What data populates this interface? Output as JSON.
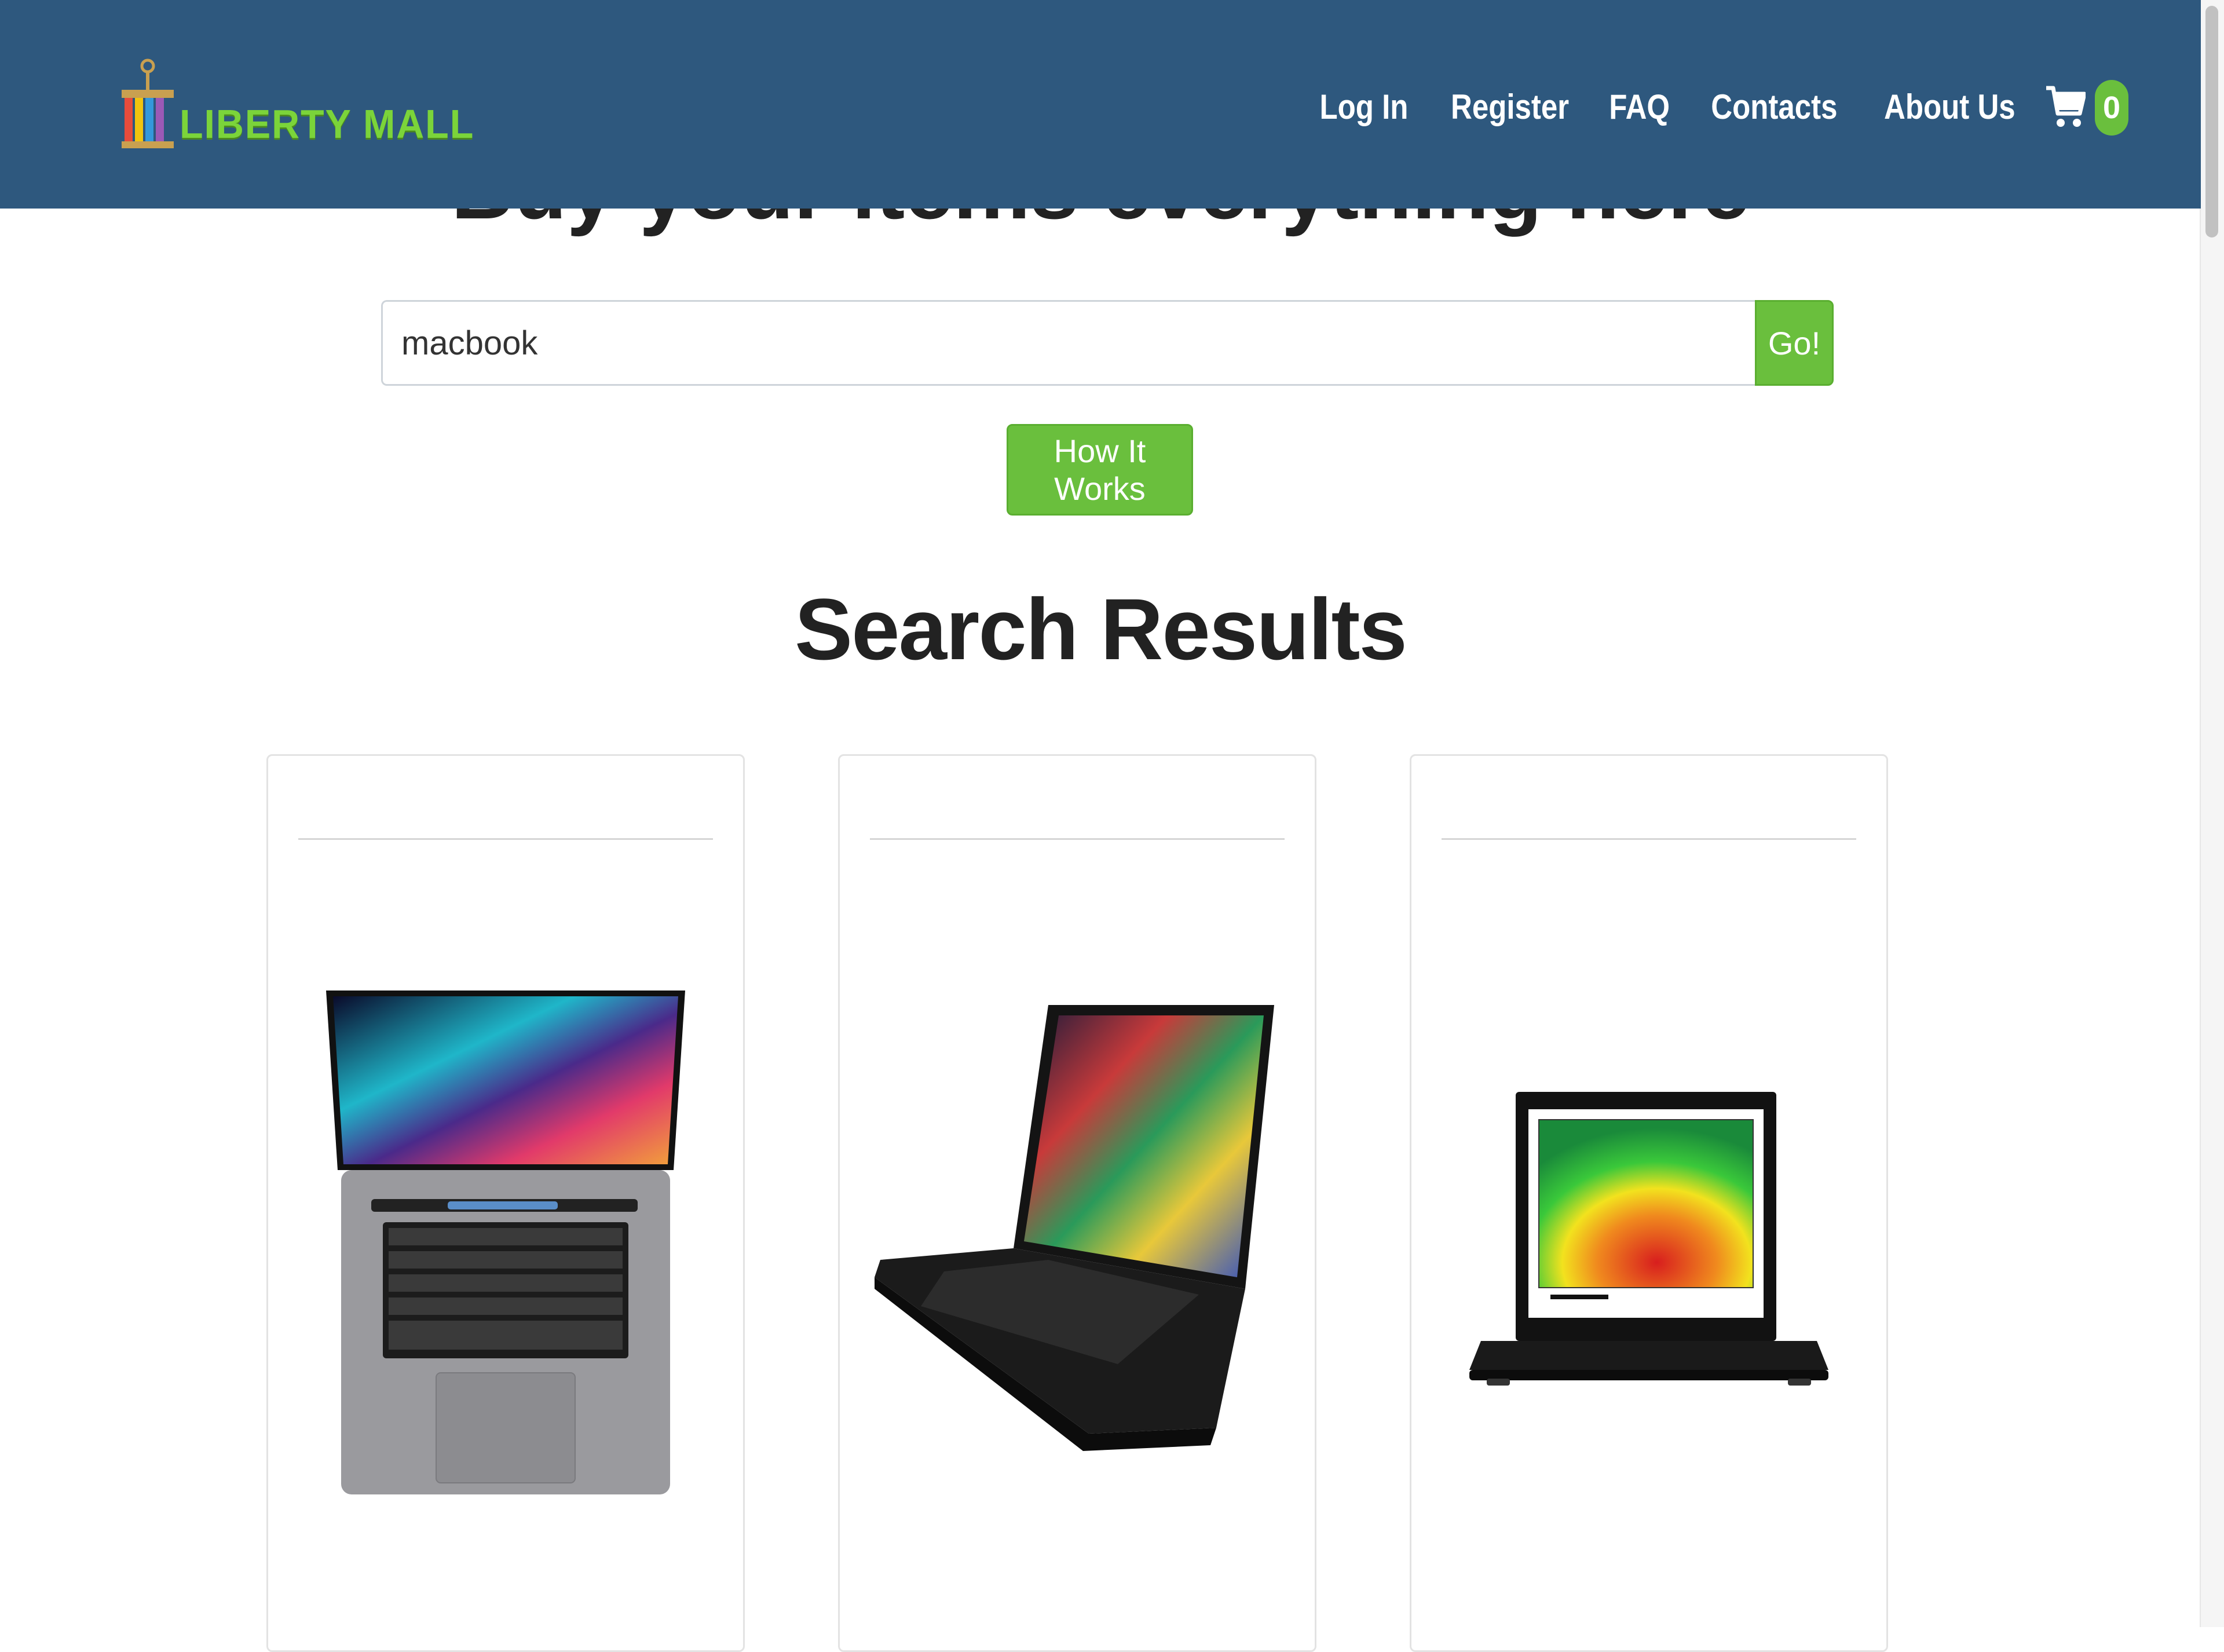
{
  "brand": {
    "name": "LIBERTY MALL",
    "colors": {
      "navbar": "#2e587e",
      "accent": "#6abf3d",
      "logo_green": "#7bd43a"
    }
  },
  "hero": {
    "heading_partial": "Buy your items everything here"
  },
  "nav": {
    "links": [
      {
        "label": "Log In"
      },
      {
        "label": "Register"
      },
      {
        "label": "FAQ"
      },
      {
        "label": "Contacts"
      },
      {
        "label": "About Us"
      }
    ],
    "cart": {
      "icon": "cart-icon",
      "count": "0"
    }
  },
  "search": {
    "value": "macbook",
    "button_label": "Go!"
  },
  "how_it_works": {
    "label": "How It Works"
  },
  "results": {
    "title": "Search Results",
    "cards": [
      {
        "image": "laptop-silver-macbook-image"
      },
      {
        "image": "laptop-black-thinkpad-angled-image"
      },
      {
        "image": "laptop-black-thinkpad-front-image"
      }
    ]
  }
}
